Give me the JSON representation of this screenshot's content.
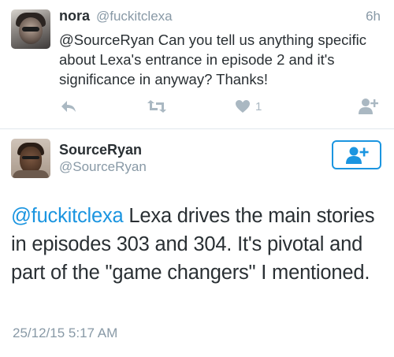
{
  "tweet1": {
    "name": "nora",
    "handle": "@fuckitclexa",
    "time": "6h",
    "text": "@SourceRyan Can you tell us anything specific about Lexa's entrance in episode 2 and it's significance in anyway? Thanks!",
    "likes": "1",
    "icons": [
      "reply-icon",
      "retweet-icon",
      "heart-icon",
      "follow-icon"
    ]
  },
  "tweet2": {
    "name": "SourceRyan",
    "handle": "@SourceRyan",
    "mention": "@fuckitclexa",
    "text": " Lexa drives the main stories in episodes 303 and 304. It's pivotal and part of the \"game changers\" I mentioned.",
    "date": "25/12/15 5:17 AM"
  },
  "colors": {
    "accent": "#1b95e0",
    "muted": "#8899a6",
    "icon": "#aab8c2",
    "text": "#292f33"
  }
}
